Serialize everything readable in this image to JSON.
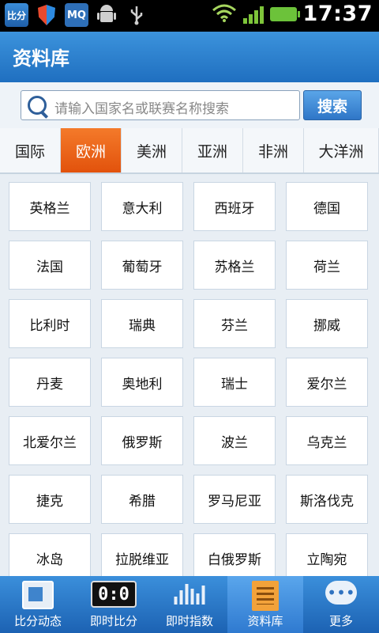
{
  "statusbar": {
    "bifen_icon_label": "比分",
    "mq_icon_label": "MQ",
    "time": "17:37",
    "icons": [
      "bifen-app-icon",
      "shield-icon",
      "mq-icon",
      "android-debug-icon",
      "usb-icon",
      "wifi-icon",
      "signal-icon",
      "battery-icon"
    ]
  },
  "titlebar": {
    "title": "资料库"
  },
  "search": {
    "placeholder": "请输入国家名或联赛名称搜索",
    "button_label": "搜索"
  },
  "tabs": [
    {
      "label": "国际",
      "active": false
    },
    {
      "label": "欧洲",
      "active": true
    },
    {
      "label": "美洲",
      "active": false
    },
    {
      "label": "亚洲",
      "active": false
    },
    {
      "label": "非洲",
      "active": false
    },
    {
      "label": "大洋洲",
      "active": false
    }
  ],
  "countries": [
    "英格兰",
    "意大利",
    "西班牙",
    "德国",
    "法国",
    "葡萄牙",
    "苏格兰",
    "荷兰",
    "比利时",
    "瑞典",
    "芬兰",
    "挪威",
    "丹麦",
    "奥地利",
    "瑞士",
    "爱尔兰",
    "北爱尔兰",
    "俄罗斯",
    "波兰",
    "乌克兰",
    "捷克",
    "希腊",
    "罗马尼亚",
    "斯洛伐克",
    "冰岛",
    "拉脱维亚",
    "白俄罗斯",
    "立陶宛"
  ],
  "bottomnav": {
    "items": [
      {
        "label": "比分动态",
        "icon": "live-score-icon",
        "active": false
      },
      {
        "label": "即时比分",
        "icon": "scoreboard-icon",
        "icon_text": "0:0",
        "active": false
      },
      {
        "label": "即时指数",
        "icon": "bar-chart-icon",
        "active": false
      },
      {
        "label": "资料库",
        "icon": "database-icon",
        "active": true
      },
      {
        "label": "更多",
        "icon": "more-icon",
        "icon_text": "•••",
        "active": false
      }
    ]
  },
  "colors": {
    "accent_blue": "#1f6fc0",
    "active_tab": "#e2520c",
    "battery_green": "#6cc23a"
  }
}
